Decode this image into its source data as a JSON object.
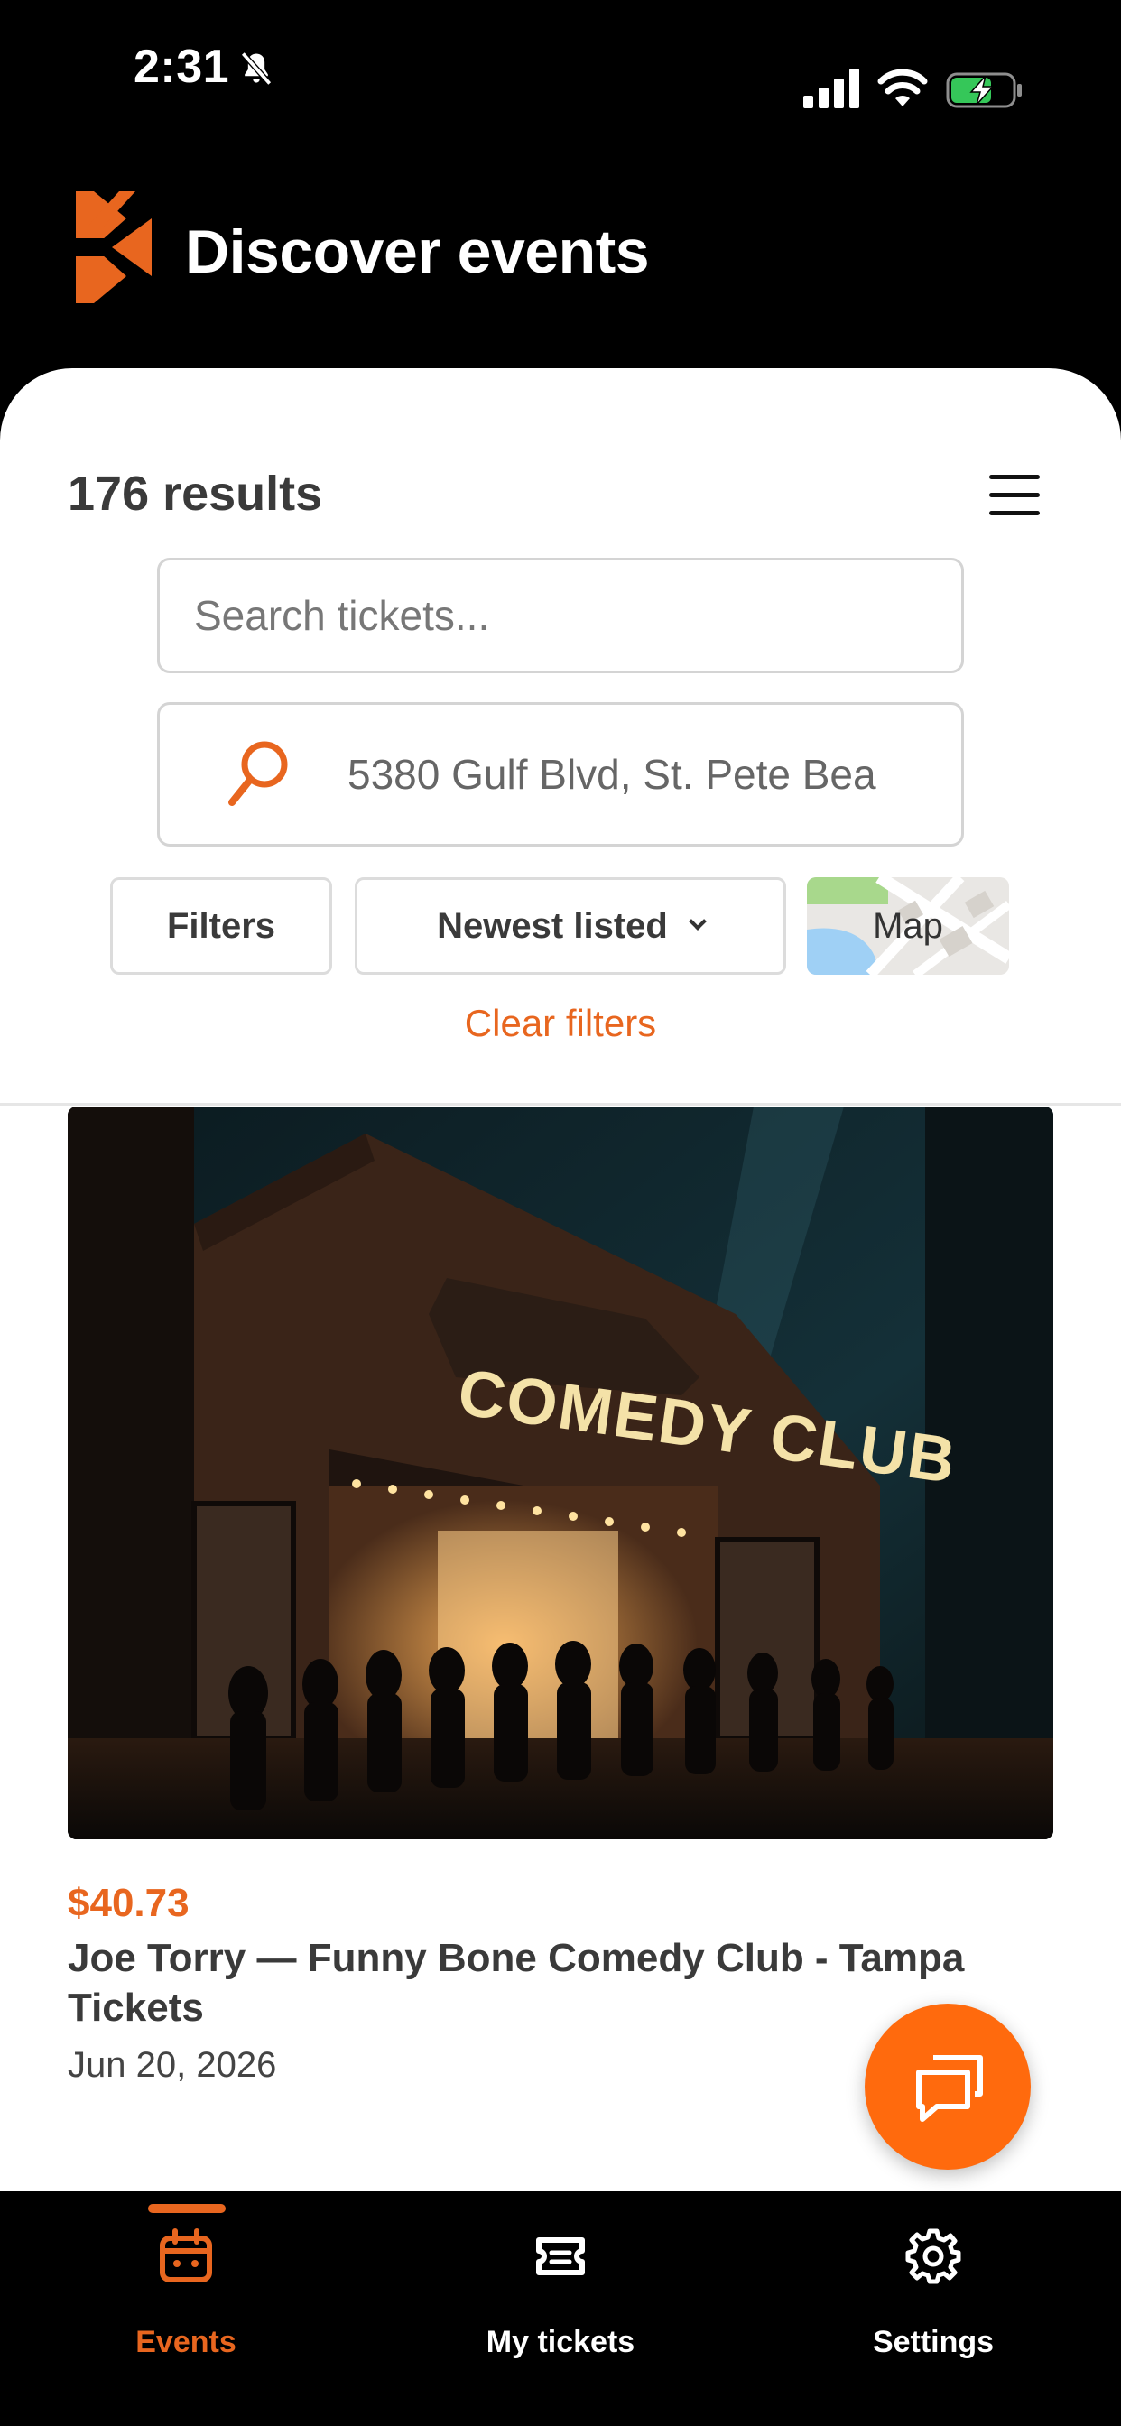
{
  "status_bar": {
    "time": "2:31",
    "icons": [
      "bell-slash-icon",
      "cellular-signal-icon",
      "wifi-icon",
      "battery-charging-icon"
    ]
  },
  "header": {
    "title": "Discover events",
    "logo": "brand-logo"
  },
  "results": {
    "count_label": "176 results"
  },
  "search": {
    "placeholder": "Search tickets...",
    "value": ""
  },
  "location": {
    "value": "5380 Gulf Blvd, St. Pete Bea",
    "icon": "search-icon"
  },
  "controls": {
    "filters_label": "Filters",
    "sort_label": "Newest listed",
    "map_label": "Map",
    "clear_filters_label": "Clear filters"
  },
  "events": [
    {
      "image_text": "COMEDY CLUB",
      "price": "$40.73",
      "title": "Joe Torry — Funny Bone Comedy Club - Tampa Tickets",
      "date": "Jun 20, 2026"
    }
  ],
  "bottom_nav": {
    "items": [
      {
        "label": "Events",
        "icon": "calendar-icon",
        "active": true
      },
      {
        "label": "My tickets",
        "icon": "ticket-icon",
        "active": false
      },
      {
        "label": "Settings",
        "icon": "gear-icon",
        "active": false
      }
    ]
  },
  "colors": {
    "accent": "#e8661f",
    "fab": "#ff6a0d",
    "background": "#000000",
    "panel": "#ffffff"
  }
}
